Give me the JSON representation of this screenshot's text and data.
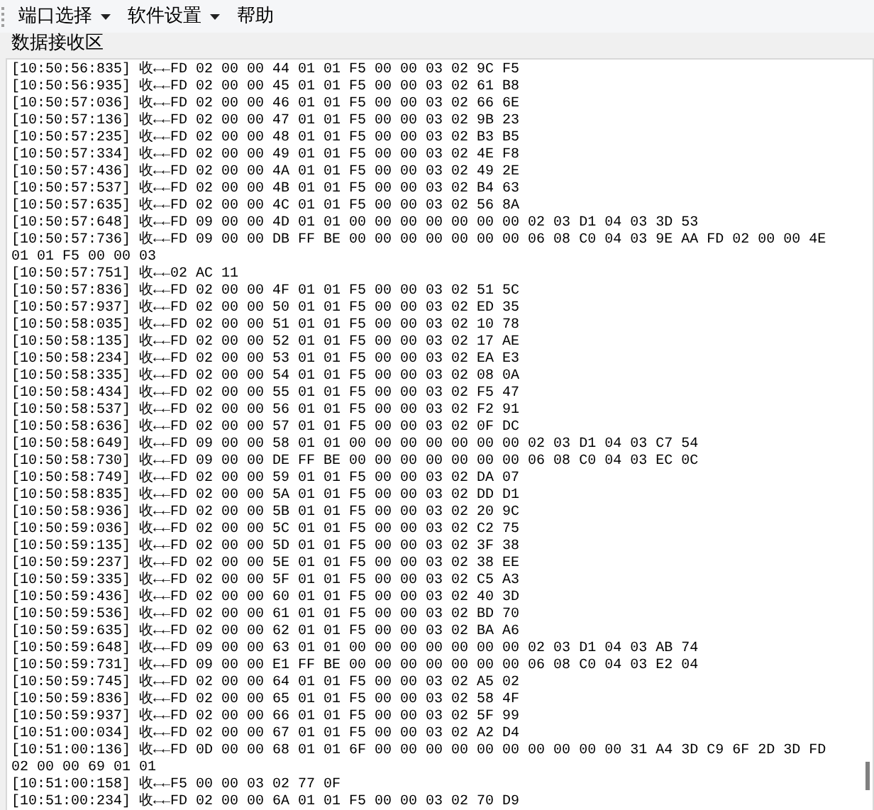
{
  "menu": [
    {
      "label": "端口选择",
      "dropdown": true
    },
    {
      "label": "软件设置",
      "dropdown": true
    },
    {
      "label": "帮助",
      "dropdown": false
    }
  ],
  "receive_area": {
    "title": "数据接收区",
    "lines": [
      "[10:50:56:835] 收←←FD 02 00 00 44 01 01 F5 00 00 03 02 9C F5",
      "[10:50:56:935] 收←←FD 02 00 00 45 01 01 F5 00 00 03 02 61 B8",
      "[10:50:57:036] 收←←FD 02 00 00 46 01 01 F5 00 00 03 02 66 6E",
      "[10:50:57:136] 收←←FD 02 00 00 47 01 01 F5 00 00 03 02 9B 23",
      "[10:50:57:235] 收←←FD 02 00 00 48 01 01 F5 00 00 03 02 B3 B5",
      "[10:50:57:334] 收←←FD 02 00 00 49 01 01 F5 00 00 03 02 4E F8",
      "[10:50:57:436] 收←←FD 02 00 00 4A 01 01 F5 00 00 03 02 49 2E",
      "[10:50:57:537] 收←←FD 02 00 00 4B 01 01 F5 00 00 03 02 B4 63",
      "[10:50:57:635] 收←←FD 02 00 00 4C 01 01 F5 00 00 03 02 56 8A",
      "[10:50:57:648] 收←←FD 09 00 00 4D 01 01 00 00 00 00 00 00 00 02 03 D1 04 03 3D 53",
      "[10:50:57:736] 收←←FD 09 00 00 DB FF BE 00 00 00 00 00 00 00 06 08 C0 04 03 9E AA FD 02 00 00 4E 01 01 F5 00 00 03",
      "[10:50:57:751] 收←←02 AC 11",
      "[10:50:57:836] 收←←FD 02 00 00 4F 01 01 F5 00 00 03 02 51 5C",
      "[10:50:57:937] 收←←FD 02 00 00 50 01 01 F5 00 00 03 02 ED 35",
      "[10:50:58:035] 收←←FD 02 00 00 51 01 01 F5 00 00 03 02 10 78",
      "[10:50:58:135] 收←←FD 02 00 00 52 01 01 F5 00 00 03 02 17 AE",
      "[10:50:58:234] 收←←FD 02 00 00 53 01 01 F5 00 00 03 02 EA E3",
      "[10:50:58:335] 收←←FD 02 00 00 54 01 01 F5 00 00 03 02 08 0A",
      "[10:50:58:434] 收←←FD 02 00 00 55 01 01 F5 00 00 03 02 F5 47",
      "[10:50:58:537] 收←←FD 02 00 00 56 01 01 F5 00 00 03 02 F2 91",
      "[10:50:58:636] 收←←FD 02 00 00 57 01 01 F5 00 00 03 02 0F DC",
      "[10:50:58:649] 收←←FD 09 00 00 58 01 01 00 00 00 00 00 00 00 02 03 D1 04 03 C7 54",
      "[10:50:58:730] 收←←FD 09 00 00 DE FF BE 00 00 00 00 00 00 00 06 08 C0 04 03 EC 0C",
      "[10:50:58:749] 收←←FD 02 00 00 59 01 01 F5 00 00 03 02 DA 07",
      "[10:50:58:835] 收←←FD 02 00 00 5A 01 01 F5 00 00 03 02 DD D1",
      "[10:50:58:936] 收←←FD 02 00 00 5B 01 01 F5 00 00 03 02 20 9C",
      "[10:50:59:036] 收←←FD 02 00 00 5C 01 01 F5 00 00 03 02 C2 75",
      "[10:50:59:135] 收←←FD 02 00 00 5D 01 01 F5 00 00 03 02 3F 38",
      "[10:50:59:237] 收←←FD 02 00 00 5E 01 01 F5 00 00 03 02 38 EE",
      "[10:50:59:335] 收←←FD 02 00 00 5F 01 01 F5 00 00 03 02 C5 A3",
      "[10:50:59:436] 收←←FD 02 00 00 60 01 01 F5 00 00 03 02 40 3D",
      "[10:50:59:536] 收←←FD 02 00 00 61 01 01 F5 00 00 03 02 BD 70",
      "[10:50:59:635] 收←←FD 02 00 00 62 01 01 F5 00 00 03 02 BA A6",
      "[10:50:59:648] 收←←FD 09 00 00 63 01 01 00 00 00 00 00 00 00 02 03 D1 04 03 AB 74",
      "[10:50:59:731] 收←←FD 09 00 00 E1 FF BE 00 00 00 00 00 00 00 06 08 C0 04 03 E2 04",
      "[10:50:59:745] 收←←FD 02 00 00 64 01 01 F5 00 00 03 02 A5 02",
      "[10:50:59:836] 收←←FD 02 00 00 65 01 01 F5 00 00 03 02 58 4F",
      "[10:50:59:937] 收←←FD 02 00 00 66 01 01 F5 00 00 03 02 5F 99",
      "[10:51:00:034] 收←←FD 02 00 00 67 01 01 F5 00 00 03 02 A2 D4",
      "[10:51:00:136] 收←←FD 0D 00 00 68 01 01 6F 00 00 00 00 00 00 00 00 00 00 31 A4 3D C9 6F 2D 3D FD 02 00 00 69 01 01",
      "[10:51:00:158] 收←←F5 00 00 03 02 77 0F",
      "[10:51:00:234] 收←←FD 02 00 00 6A 01 01 F5 00 00 03 02 70 D9"
    ]
  }
}
